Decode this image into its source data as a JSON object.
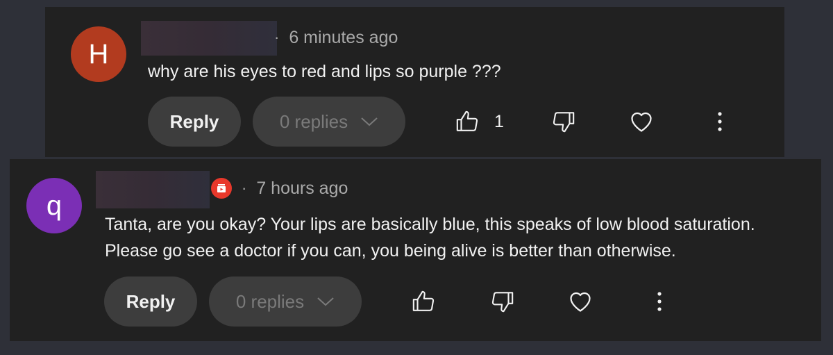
{
  "comments": [
    {
      "avatar_letter": "H",
      "avatar_color": "#b23b1f",
      "time": "6 minutes ago",
      "separator": "·",
      "lines": [
        "why are his eyes to red and lips so purple ???"
      ],
      "reply_label": "Reply",
      "replies_label": "0 replies",
      "like_count": "1"
    },
    {
      "avatar_letter": "q",
      "avatar_color": "#7b2fb5",
      "time": "7 hours ago",
      "separator": "·",
      "badge_icon": "member-badge-icon",
      "lines": [
        "Tanta, are you okay? Your lips are basically blue, this speaks of low blood saturation.",
        "Please go see a doctor if you can, you being alive is better than otherwise."
      ],
      "reply_label": "Reply",
      "replies_label": "0 replies",
      "like_count": ""
    }
  ],
  "colors": {
    "background": "#2e3038",
    "card": "#212121",
    "button": "#3d3d3d",
    "badge": "#e8382b"
  }
}
